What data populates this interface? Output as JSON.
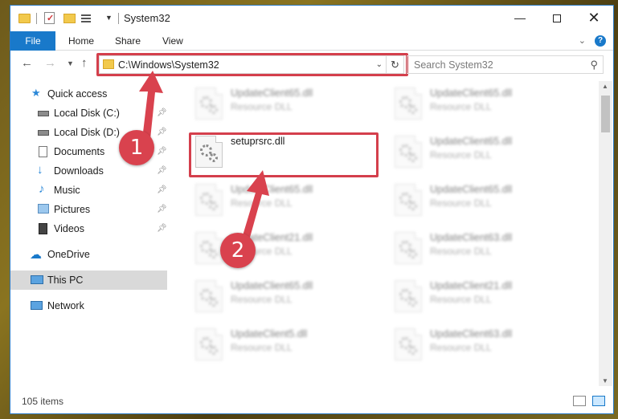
{
  "window": {
    "title": "System32",
    "controls": {
      "minimize": "—",
      "close": "✕"
    }
  },
  "ribbon": {
    "tabs": [
      "File",
      "Home",
      "Share",
      "View"
    ]
  },
  "navigation": {
    "address": "C:\\Windows\\System32",
    "search_placeholder": "Search System32"
  },
  "sidebar": {
    "items": [
      {
        "label": "Quick access",
        "icon": "star-icon",
        "pinned": false
      },
      {
        "label": "Local Disk (C:)",
        "icon": "drive-icon",
        "pinned": true
      },
      {
        "label": "Local Disk (D:)",
        "icon": "drive-icon",
        "pinned": true
      },
      {
        "label": "Documents",
        "icon": "document-icon",
        "pinned": true
      },
      {
        "label": "Downloads",
        "icon": "download-icon",
        "pinned": true
      },
      {
        "label": "Music",
        "icon": "music-icon",
        "pinned": true
      },
      {
        "label": "Pictures",
        "icon": "pictures-icon",
        "pinned": true
      },
      {
        "label": "Videos",
        "icon": "video-icon",
        "pinned": true
      },
      {
        "label": "OneDrive",
        "icon": "cloud-icon",
        "pinned": false
      },
      {
        "label": "This PC",
        "icon": "computer-icon",
        "pinned": false
      },
      {
        "label": "Network",
        "icon": "network-icon",
        "pinned": false
      }
    ]
  },
  "files": {
    "left_column": [
      {
        "name": "UpdateClient65.dll",
        "type": "Resource DLL"
      },
      {
        "name": "setuprsrc.dll",
        "type": ""
      },
      {
        "name": "UpdateClient65.dll",
        "type": "Resource DLL"
      },
      {
        "name": "UpdateClient21.dll",
        "type": "Resource DLL"
      },
      {
        "name": "UpdateClient65.dll",
        "type": "Resource DLL"
      },
      {
        "name": "UpdateClient5.dll",
        "type": "Resource DLL"
      }
    ],
    "right_column": [
      {
        "name": "UpdateClient65.dll",
        "type": "Resource DLL"
      },
      {
        "name": "UpdateClient65.dll",
        "type": "Resource DLL"
      },
      {
        "name": "UpdateClient65.dll",
        "type": "Resource DLL"
      },
      {
        "name": "UpdateClient63.dll",
        "type": "Resource DLL"
      },
      {
        "name": "UpdateClient21.dll",
        "type": "Resource DLL"
      },
      {
        "name": "UpdateClient63.dll",
        "type": "Resource DLL"
      }
    ]
  },
  "status": {
    "item_count": "105 items"
  },
  "annotations": {
    "step1": "1",
    "step2": "2"
  },
  "colors": {
    "accent": "#1979ca",
    "highlight": "#d43f4c"
  }
}
